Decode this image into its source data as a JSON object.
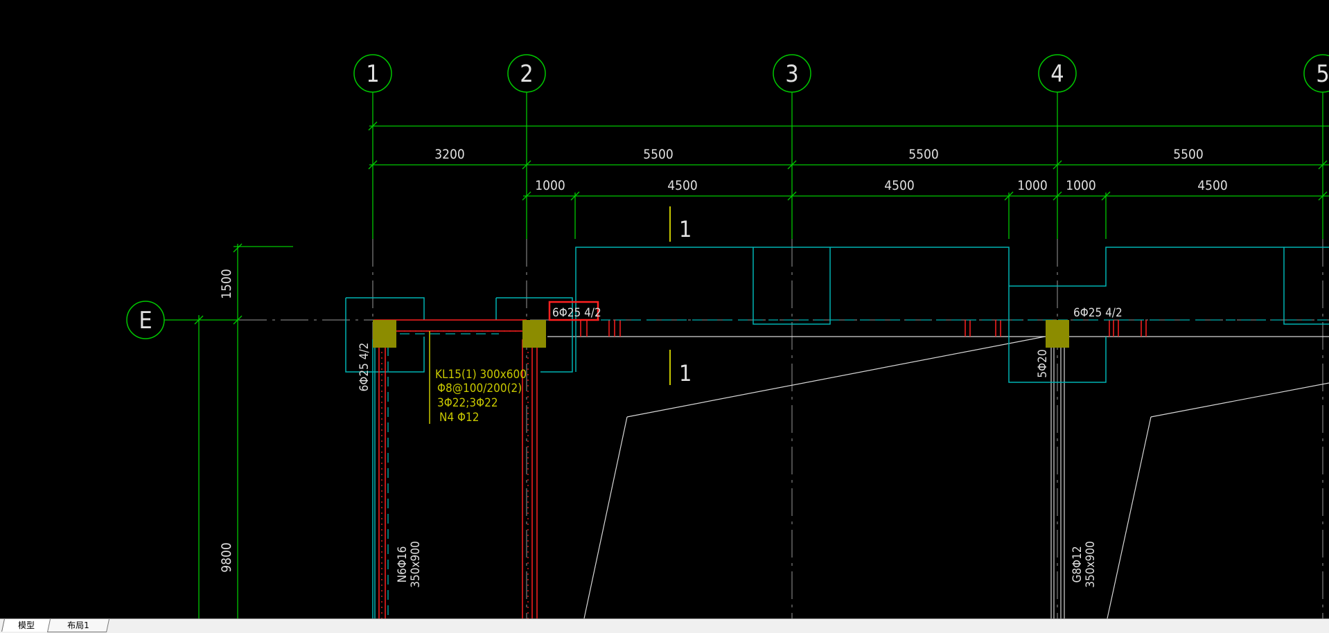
{
  "colors": {
    "background": "#000000",
    "grid": "#00c800",
    "cyan": "#00b4b4",
    "yellow": "#c8c800",
    "red": "#ff2020",
    "white": "#e0e0e0",
    "column_fill": "#8c8c00"
  },
  "axes": {
    "vertical": [
      "1",
      "2",
      "3",
      "4",
      "5"
    ],
    "horizontal": [
      "E"
    ]
  },
  "dimensions": {
    "row1": [
      "3200",
      "5500",
      "5500",
      "5500"
    ],
    "row2": [
      "1000",
      "4500",
      "4500",
      "1000",
      "1000",
      "4500"
    ],
    "left": [
      "1500",
      "9800"
    ]
  },
  "section_marks": [
    "1",
    "1"
  ],
  "annotations": {
    "highlight": "6Φ25 4/2",
    "right_top": "6Φ25 4/2",
    "left_vertical": "6Φ25 4/2",
    "beam_label": [
      "KL15(1) 300x600",
      "Φ8@100/200(2)",
      "3Φ22;3Φ22",
      "N4 Φ12"
    ],
    "col1_a": "N6Φ16",
    "col1_b": "350x900",
    "col4_top": "5Φ20",
    "col4_a": "G8Φ12",
    "col4_b": "350x900"
  },
  "tabs": [
    "模型",
    "布局1"
  ]
}
